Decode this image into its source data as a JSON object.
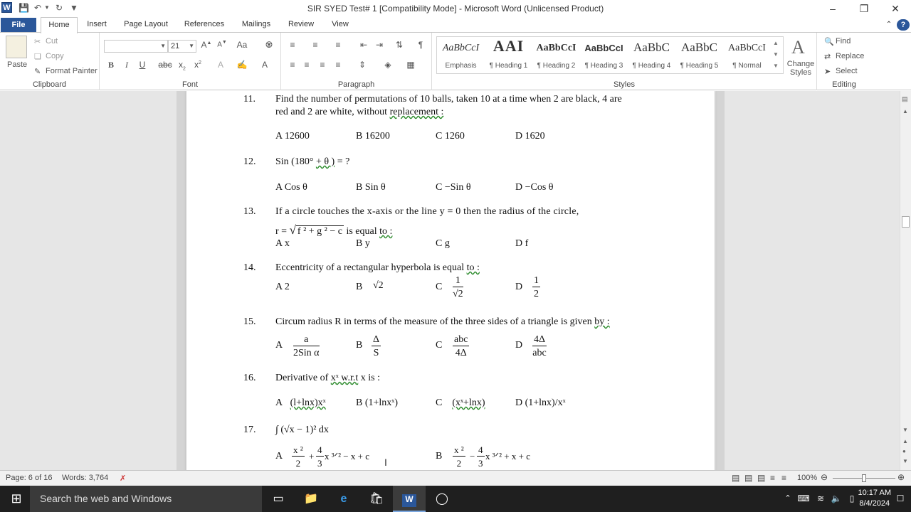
{
  "titlebar": {
    "title": "SIR SYED Test# 1 [Compatibility Mode]  -  Microsoft Word (Unlicensed Product)",
    "app_icon": "W"
  },
  "tabs": [
    "File",
    "Home",
    "Insert",
    "Page Layout",
    "References",
    "Mailings",
    "Review",
    "View"
  ],
  "clipboard": {
    "paste": "Paste",
    "cut": "Cut",
    "copy": "Copy",
    "format_painter": "Format Painter",
    "label": "Clipboard"
  },
  "font": {
    "name": "",
    "size": "21",
    "label": "Font"
  },
  "paragraph": {
    "label": "Paragraph"
  },
  "styles": {
    "label": "Styles",
    "items": [
      {
        "preview": "AaBbCcI",
        "name": "Emphasis"
      },
      {
        "preview": "AAI",
        "name": "¶ Heading 1"
      },
      {
        "preview": "AaBbCcI",
        "name": "¶ Heading 2"
      },
      {
        "preview": "AaBbCcI",
        "name": "¶ Heading 3"
      },
      {
        "preview": "AaBbC",
        "name": "¶ Heading 4"
      },
      {
        "preview": "AaBbC",
        "name": "¶ Heading 5"
      },
      {
        "preview": "AaBbCcI",
        "name": "¶ Normal"
      }
    ],
    "change_styles": "Change Styles"
  },
  "editing": {
    "find": "Find",
    "replace": "Replace",
    "select": "Select",
    "label": "Editing"
  },
  "questions": {
    "q11": {
      "num": "11.",
      "line1": "Find the number of permutations of 10 balls, taken 10 at a time when 2 are black, 4 are",
      "line2_a": "red and 2 are white, without ",
      "line2_b": "replacement :",
      "a": "A  12600",
      "b": "B    16200",
      "c": "C    1260",
      "d": "D    1620"
    },
    "q12": {
      "num": "12.",
      "text_a": "Sin (180° ",
      "text_b": "+ θ )",
      "text_c": "  = ?",
      "a": "A   Cos θ",
      "b": "B   Sin θ",
      "c": "C   −Sin  θ",
      "d": "D   −Cos  θ"
    },
    "q13": {
      "num": "13.",
      "line1": "If  a  circle  touches  the  x-axis  or  the  line  y  =  0  then  the  radius  of  the  circle,",
      "r_eq": "r =",
      "radicand": "f ² + g ² − c",
      "tail_a": "  is equal ",
      "tail_b": "to :",
      "a": "A   x",
      "b": "B   y",
      "c": "C   g",
      "d": "D   f"
    },
    "q14": {
      "num": "14.",
      "text_a": "Eccentricity of a rectangular hyperbola is equal ",
      "text_b": "to :",
      "a": "A   2",
      "b_letter": "B",
      "b_val": "√2",
      "c_letter": "C",
      "c_num": "1",
      "c_den": "√2",
      "d_letter": "D",
      "d_num": "1",
      "d_den": "2"
    },
    "q15": {
      "num": "15.",
      "text_a": "Circum radius R in terms of the measure of the three sides of a triangle is given ",
      "text_b": "by :",
      "a_letter": "A",
      "a_num": "a",
      "a_den": "2Sin α",
      "b_letter": "B",
      "b_num": "Δ",
      "b_den": "S",
      "c_letter": "C",
      "c_num": "abc",
      "c_den": "4Δ",
      "d_letter": "D",
      "d_num": "4Δ",
      "d_den": "abc"
    },
    "q16": {
      "num": "16.",
      "text_a": "Derivative of ",
      "text_b": "xˣ  w.r.t",
      "text_c": " x is :",
      "a_letter": "A",
      "a_val": "(l+lnx)xˣ",
      "b": "B    (1+lnxˣ)",
      "c_letter": "C",
      "c_val": "(xˣ+lnx)",
      "d": "D    (1+lnx)/xˣ"
    },
    "q17": {
      "num": "17.",
      "integral": "∫ (√x − 1)²  dx",
      "a_letter": "A",
      "a_tail": "+ ",
      "a_exp": "x ³ᐟ² − x + c",
      "b_letter": "B",
      "b_tail": "− ",
      "b_exp": "x ³ᐟ² + x + c",
      "x2": "x ²",
      "two": "2",
      "four": "4",
      "three": "3"
    }
  },
  "statusbar": {
    "page": "Page: 6 of 16",
    "words": "Words: 3,764",
    "zoom": "100%"
  },
  "taskbar": {
    "search": "Search the web and Windows",
    "time": "10:17 AM",
    "date": "8/4/2024"
  }
}
